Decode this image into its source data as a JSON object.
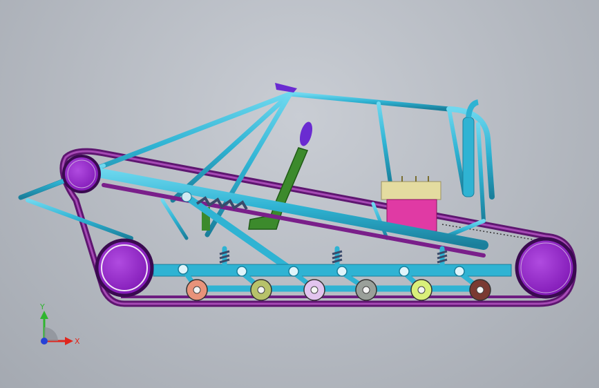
{
  "view": {
    "background_top": "#c9cdd4",
    "background_bottom": "#a4a9b1"
  },
  "colors": {
    "frame_tube": "#2fb3d3",
    "frame_tube_dark": "#1a7f9b",
    "track_belt": "#7a1f8a",
    "track_belt_light": "#a64ab5",
    "drive_wheel": "#8e24c7",
    "seat": "#3c8a2c",
    "steering_knob": "#6a2bd1",
    "engine_block": "#e4dca0",
    "engine_housing": "#e03aa4",
    "bogie_wheels": [
      "#e8937a",
      "#b7c26a",
      "#e2c4ee",
      "#9aa09a",
      "#d9ef7a",
      "#7a3a32"
    ]
  },
  "triad": {
    "x_label": "X",
    "y_label": "Y",
    "x_color": "#e0261d",
    "y_color": "#2fb52f",
    "z_color": "#2741d6"
  }
}
